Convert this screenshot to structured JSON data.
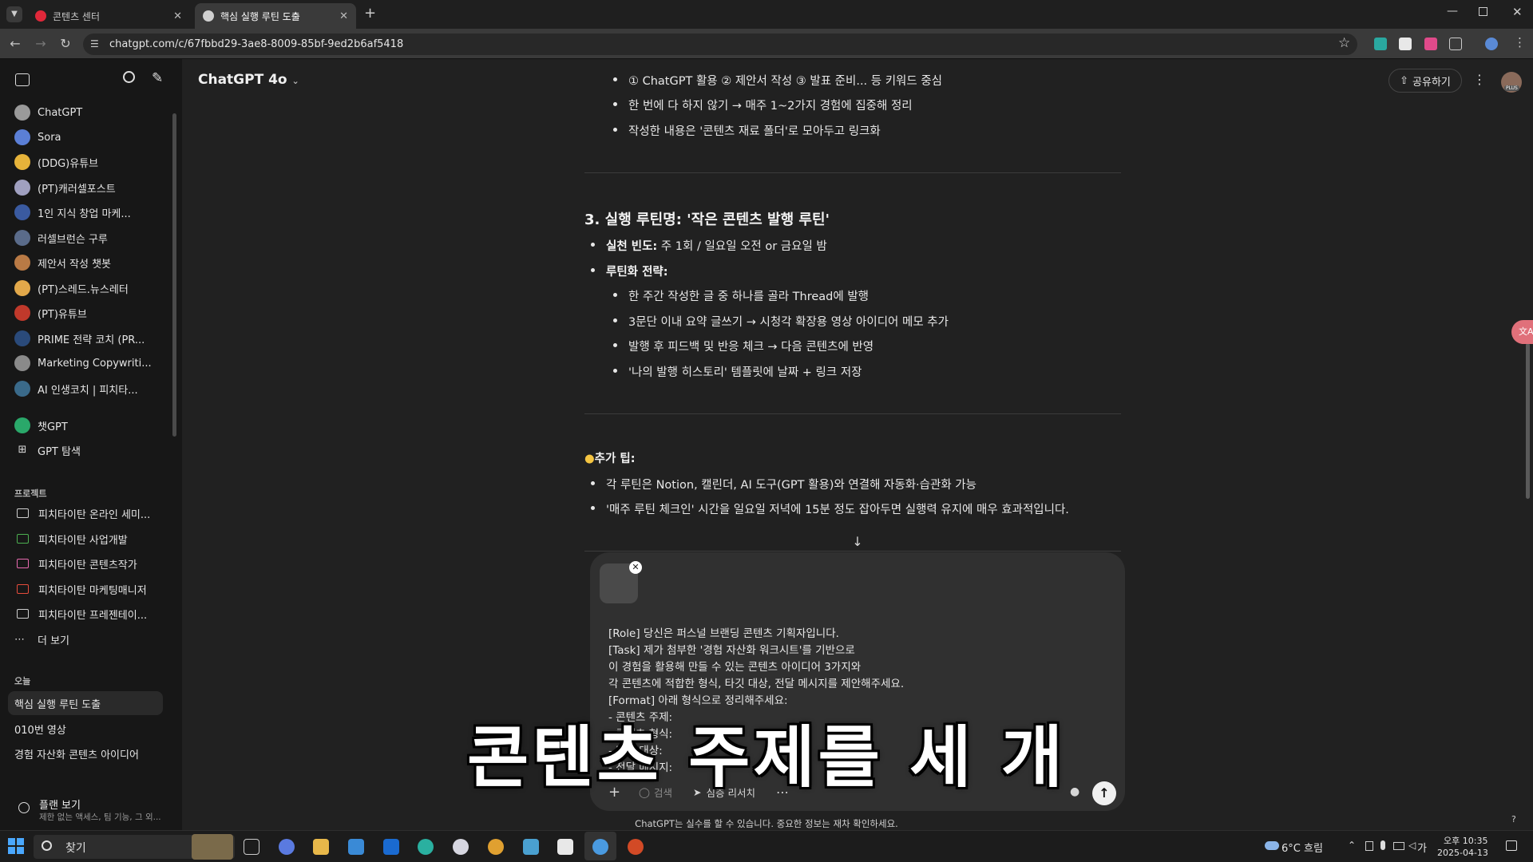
{
  "browser": {
    "tabs": [
      {
        "title": "콘텐츠 센터",
        "active": false,
        "favicon_color": "#e0283a"
      },
      {
        "title": "핵심 실행 루틴 도출",
        "active": true,
        "favicon_color": "#d0d0d0"
      }
    ],
    "url": "chatgpt.com/c/67fbbd29-3ae8-8009-85bf-9ed2b6af5418"
  },
  "sidebar": {
    "gpts": [
      {
        "label": "ChatGPT",
        "color": "#9a9a9a"
      },
      {
        "label": "Sora",
        "color": "#5b7fd6"
      },
      {
        "label": "(DDG)유튜브",
        "color": "#e6b33a"
      },
      {
        "label": "(PT)캐러셀포스트",
        "color": "#a0a0c0"
      },
      {
        "label": "1인 지식 창업 마케...",
        "color": "#3a5aa0"
      },
      {
        "label": "러셀브런슨 구루",
        "color": "#5a6b8a"
      },
      {
        "label": "제안서 작성 챗봇",
        "color": "#b97a45"
      },
      {
        "label": "(PT)스레드.뉴스레터",
        "color": "#e2a84a"
      },
      {
        "label": "(PT)유튜브",
        "color": "#c0392b"
      },
      {
        "label": "PRIME 전략 코치 (PR...",
        "color": "#2a4a7a"
      },
      {
        "label": "Marketing Copywriti...",
        "color": "#8a8a8a"
      },
      {
        "label": "AI 인생코치 | 피치타...",
        "color": "#3a6a8a"
      },
      {
        "label": "챗GPT",
        "color": "#2aa86a"
      },
      {
        "label": "GPT 탐색",
        "color": "#171717"
      }
    ],
    "projects_label": "프로젝트",
    "projects": [
      {
        "label": "피치타이탄 온라인 세미...",
        "color": "#cfcfcf"
      },
      {
        "label": "피치타이탄 사업개발",
        "color": "#4caf50"
      },
      {
        "label": "피치타이탄 콘텐츠작가",
        "color": "#e86ab0"
      },
      {
        "label": "피치타이탄 마케팅매니저",
        "color": "#e74c3c"
      },
      {
        "label": "피치타이탄 프레젠테이...",
        "color": "#cfcfcf"
      }
    ],
    "more_label": "더 보기",
    "today_label": "오늘",
    "history": [
      "핵심 실행 루틴 도출",
      "010번 영상",
      "경험 자산화 콘텐츠 아이디어"
    ],
    "plan_title": "플랜 보기",
    "plan_sub": "제한 없는 액세스, 팀 기능, 그 외..."
  },
  "header": {
    "model": "ChatGPT 4o",
    "share": "공유하기",
    "plus_badge": "PLUS"
  },
  "content": {
    "top_bullets": [
      "① ChatGPT 활용 ② 제안서 작성 ③ 발표 준비... 등 키워드 중심",
      "한 번에 다 하지 않기 → 매주 1~2가지 경험에 집중해 정리",
      "작성한 내용은 '콘텐츠 재료 폴더'로 모아두고 링크화"
    ],
    "section3_title": "3. 실행 루틴명: '작은 콘텐츠 발행 루틴'",
    "freq_label": "실천 빈도:",
    "freq_value": " 주 1회 / 일요일 오전 or 금요일 밤",
    "strategy_label": "루틴화 전략:",
    "strategy_bullets": [
      "한 주간 작성한 글 중 하나를 골라 Thread에 발행",
      "3문단 이내 요약 글쓰기 → 시청각 확장용 영상 아이디어 메모 추가",
      "발행 후 피드백 및 반응 체크 → 다음 콘텐츠에 반영",
      "'나의 발행 히스토리' 템플릿에 날짜 + 링크 저장"
    ],
    "tip_title": "추가 팁:",
    "tip_bullets": [
      "각 루틴은 Notion, 캘린더, AI 도구(GPT 활용)와 연결해 자동화·습관화 가능",
      "'매주 루틴 체크인' 시간을 일요일 저녁에 15분 정도 잡아두면 실행력 유지에 매우 효과적입니다."
    ]
  },
  "composer": {
    "lines": [
      "[Role] 당신은 퍼스널 브랜딩 콘텐츠 기획자입니다.",
      "[Task] 제가 첨부한 '경험 자산화 워크시트'를 기반으로",
      "이 경험을 활용해 만들 수 있는 콘텐츠 아이디어 3가지와",
      "각 콘텐츠에 적합한 형식, 타깃 대상, 전달 메시지를 제안해주세요.",
      "[Format] 아래 형식으로 정리해주세요:",
      "- 콘텐츠 주제:",
      "- 콘텐츠 형식:",
      "- 타깃 대상:",
      "- 전달 메시지:"
    ],
    "search_label": "검색",
    "deep_research_label": "심층 리서치",
    "disclaimer": "ChatGPT는 실수를 할 수 있습니다. 중요한 정보는 재차 확인하세요."
  },
  "subtitle": "콘텐츠 주제를 세 개",
  "taskbar": {
    "search_text": "찾기",
    "weather": "6°C 흐림",
    "lang": "가",
    "time": "오후 10:35",
    "date": "2025-04-13"
  }
}
